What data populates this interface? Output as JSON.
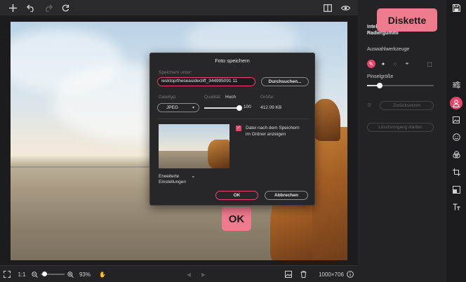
{
  "toolbar": {
    "add_icon": "plus-icon",
    "undo_icon": "undo-icon",
    "redo_icon": "redo-icon",
    "reset_icon": "refresh-icon",
    "compare_icon": "compare-icon",
    "preview_icon": "eye-icon"
  },
  "callouts": {
    "top": "Diskette",
    "bottom": "OK"
  },
  "dialog": {
    "title": "Foto speichern",
    "save_under_label": "Speichern unter:",
    "path_value": "iesktop/theseasidecliff_344995091 11",
    "browse_button": "Durchsuchen...",
    "file_type_label": "Dateityp:",
    "file_type_value": "JPEG",
    "quality_label": "Qualität:",
    "quality_level": "Hoch",
    "quality_value": "100",
    "quality_fraction": 1.0,
    "size_label": "Größe:",
    "size_value": "412.09 KB",
    "show_in_folder_label": "Datei nach dem Speichern im Ordner anzeigen",
    "show_in_folder_checked": true,
    "advanced_label": "Erweiterte Einstellungen",
    "ok_button": "OK",
    "cancel_button": "Abbrechen"
  },
  "panel": {
    "heading": "Intelligenter Radiergummi",
    "selection_tools_label": "Auswahlwerkzeuge",
    "brush_size_label": "Pinselgröße",
    "reset_button": "Zurücksetzen",
    "start_button": "Löschvorgang starten"
  },
  "bottom": {
    "zoom_ratio": "1:1",
    "zoom_value": "93%",
    "dimensions": "1000×706"
  },
  "colors": {
    "accent": "#e8446a",
    "callout": "#f07a8e",
    "panel_bg": "#232326"
  }
}
